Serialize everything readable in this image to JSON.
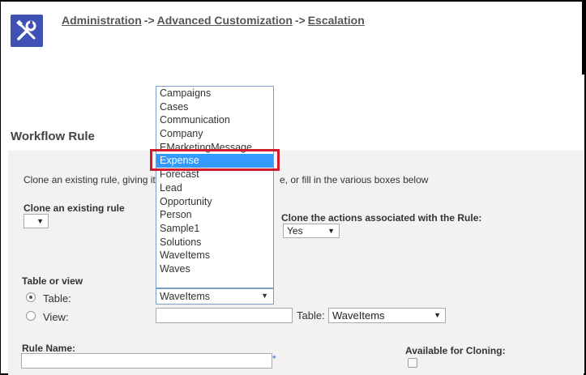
{
  "breadcrumb": {
    "items": [
      "Administration",
      "Advanced Customization",
      "Escalation"
    ],
    "separator": "->"
  },
  "section_title": "Workflow Rule",
  "clone_intro": "Clone an existing rule, giving it",
  "clone_intro_tail": "e, or fill in the various boxes below",
  "clone_existing": {
    "label": "Clone an existing rule",
    "value": ""
  },
  "clone_actions": {
    "label": "Clone the actions associated with the Rule:",
    "value": "Yes"
  },
  "table_or_view": {
    "label": "Table or view",
    "table_label": "Table:",
    "view_label": "View:",
    "table_value": "WaveItems",
    "view_table_label": "Table:",
    "view_table_value": "WaveItems"
  },
  "dropdown_options": [
    "Campaigns",
    "Cases",
    "Communication",
    "Company",
    "EMarketingMessage",
    "Expense",
    "Forecast",
    "Lead",
    "Opportunity",
    "Person",
    "Sample1",
    "Solutions",
    "WaveItems",
    "Waves"
  ],
  "dropdown_selected": "Expense",
  "rule_name": {
    "label": "Rule Name:",
    "value": "",
    "required_marker": "*"
  },
  "available_for_cloning": {
    "label": "Available for Cloning:"
  },
  "colors": {
    "accent": "#3399ff",
    "highlight": "#d11a2a",
    "icon_bg": "#3f51b5"
  }
}
